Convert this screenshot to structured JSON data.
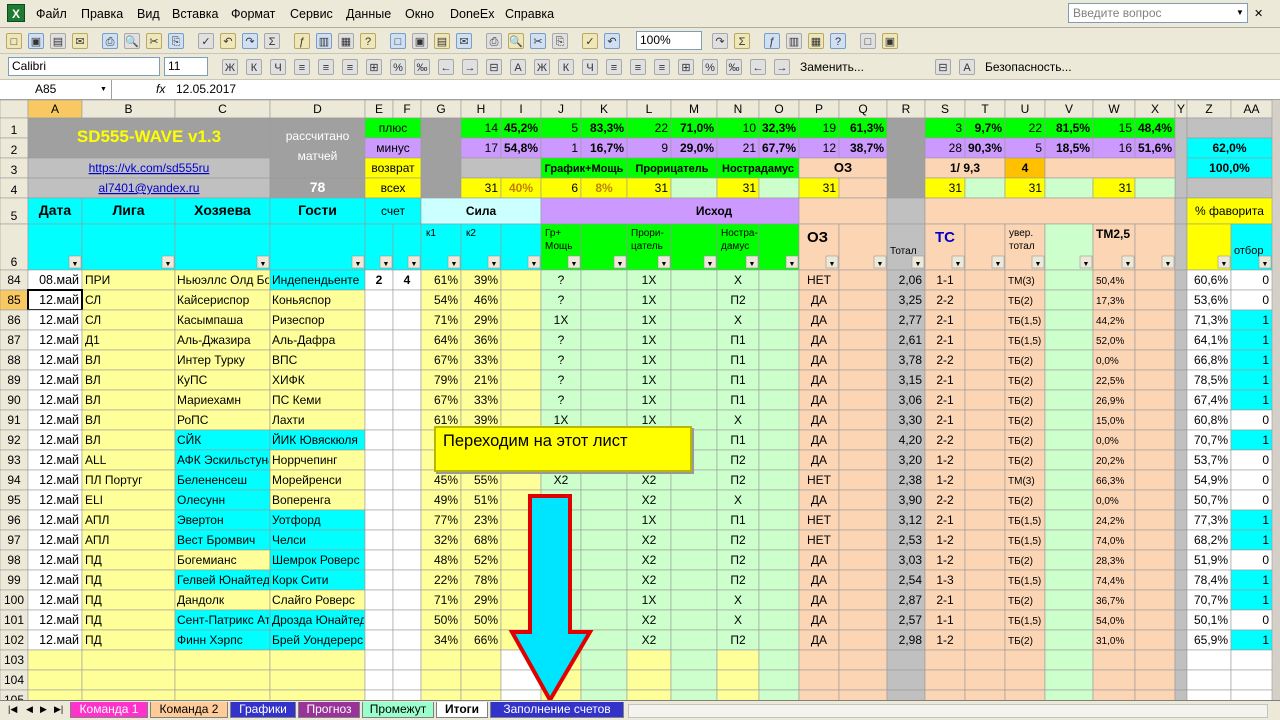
{
  "app": {
    "logo": "X",
    "menu": [
      "Файл",
      "Правка",
      "Вид",
      "Вставка",
      "Формат",
      "Сервис",
      "Данные",
      "Окно",
      "DoneEx",
      "Справка"
    ],
    "question_placeholder": "Введите вопрос"
  },
  "toolbar": {
    "zoom": "100%",
    "font": "Calibri",
    "font_size": "11",
    "replace_label": "Заменить...",
    "security_label": "Безопасность..."
  },
  "formula_bar": {
    "cell": "A85",
    "fx": "fx",
    "value": "12.05.2017"
  },
  "columns": [
    "A",
    "B",
    "C",
    "D",
    "E",
    "F",
    "G",
    "H",
    "I",
    "J",
    "K",
    "L",
    "M",
    "N",
    "O",
    "P",
    "Q",
    "R",
    "S",
    "T",
    "U",
    "V",
    "W",
    "X",
    "Y",
    "Z",
    "AA"
  ],
  "header": {
    "title": "SD555-WAVE v1.3",
    "link1": "https://vk.com/sd555ru",
    "link2": "al7401@yandex.ru",
    "calc_label": "рассчитано матчей",
    "calc_count": "78",
    "plus": "плюс",
    "minus": "минус",
    "ret": "возврат",
    "all": "всех",
    "r1": [
      "14",
      "45,2%",
      "5",
      "83,3%",
      "22",
      "71,0%",
      "10",
      "32,3%",
      "19",
      "61,3%",
      "3",
      "9,7%",
      "22",
      "81,5%",
      "15",
      "48,4%"
    ],
    "r2": [
      "17",
      "54,8%",
      "1",
      "16,7%",
      "9",
      "29,0%",
      "21",
      "67,7%",
      "12",
      "38,7%",
      "28",
      "90,3%",
      "5",
      "18,5%",
      "16",
      "51,6%"
    ],
    "z1": "62,0%",
    "z2": "100,0%",
    "r3": {
      "gm": "График+Мощь",
      "pr": "Прорицатель",
      "ns": "Нострадамус",
      "o3": "ОЗ",
      "s3": "1/ 9,3",
      "u3": "4"
    },
    "r4": {
      "h": "31",
      "i": "40%",
      "j": "6",
      "k": "8%",
      "l": "31",
      "n": "31",
      "p": "31",
      "s": "31",
      "u": "31",
      "w": "31"
    },
    "r5": {
      "date": "Дата",
      "league": "Лига",
      "home": "Хозяева",
      "away": "Гости",
      "score": "счет",
      "power": "Сила",
      "outcome": "Исход",
      "fav": "% фаворита"
    },
    "r6": {
      "k1": "к1",
      "k2": "к2",
      "grm": "Гр+ Мощь",
      "pror": "Проpи- цатель",
      "nostr": "Ностра- дамус",
      "oz": "ОЗ",
      "total": "Тотал",
      "tc": "ТС",
      "uvt": "увер. тотал",
      "tm25": "ТМ2,5",
      "otb": "отбор"
    }
  },
  "rows": [
    {
      "n": "84",
      "a": "08.май",
      "b": "ПРИ",
      "c": "Ньюэллс Олд Бойз",
      "d": "Индепендьенте",
      "e": "2",
      "f": "4",
      "g": "61%",
      "h": "39%",
      "j": "?",
      "l": "1Х",
      "n2": "Х",
      "p": "НЕТ",
      "r": "2,06",
      "s": "1-1",
      "u": "ТМ(3)",
      "w": "50,4%",
      "z": "60,6%",
      "aa": "0"
    },
    {
      "n": "85",
      "a": "12.май",
      "b": "СЛ",
      "c": "Кайсериспор",
      "d": "Коньяспор",
      "e": "",
      "f": "",
      "g": "54%",
      "h": "46%",
      "j": "?",
      "l": "1Х",
      "n2": "П2",
      "p": "ДА",
      "r": "3,25",
      "s": "2-2",
      "u": "ТБ(2)",
      "w": "17,3%",
      "z": "53,6%",
      "aa": "0"
    },
    {
      "n": "86",
      "a": "12.май",
      "b": "СЛ",
      "c": "Касымпаша",
      "d": "Ризеспор",
      "e": "",
      "f": "",
      "g": "71%",
      "h": "29%",
      "j": "1Х",
      "l": "1Х",
      "n2": "Х",
      "p": "ДА",
      "r": "2,77",
      "s": "2-1",
      "u": "ТБ(1,5)",
      "w": "44,2%",
      "z": "71,3%",
      "aa": "1"
    },
    {
      "n": "87",
      "a": "12.май",
      "b": "Д1",
      "c": "Аль-Джазира",
      "d": "Аль-Дафра",
      "e": "",
      "f": "",
      "g": "64%",
      "h": "36%",
      "j": "?",
      "l": "1Х",
      "n2": "П1",
      "p": "ДА",
      "r": "2,61",
      "s": "2-1",
      "u": "ТБ(1,5)",
      "w": "52,0%",
      "z": "64,1%",
      "aa": "1"
    },
    {
      "n": "88",
      "a": "12.май",
      "b": "ВЛ",
      "c": "Интер Турку",
      "d": "ВПС",
      "e": "",
      "f": "",
      "g": "67%",
      "h": "33%",
      "j": "?",
      "l": "1Х",
      "n2": "П1",
      "p": "ДА",
      "r": "3,78",
      "s": "2-2",
      "u": "ТБ(2)",
      "w": "0,0%",
      "z": "66,8%",
      "aa": "1"
    },
    {
      "n": "89",
      "a": "12.май",
      "b": "ВЛ",
      "c": "КуПС",
      "d": "ХИФК",
      "e": "",
      "f": "",
      "g": "79%",
      "h": "21%",
      "j": "?",
      "l": "1Х",
      "n2": "П1",
      "p": "ДА",
      "r": "3,15",
      "s": "2-1",
      "u": "ТБ(2)",
      "w": "22,5%",
      "z": "78,5%",
      "aa": "1"
    },
    {
      "n": "90",
      "a": "12.май",
      "b": "ВЛ",
      "c": "Мариехамн",
      "d": "ПС Кеми",
      "e": "",
      "f": "",
      "g": "67%",
      "h": "33%",
      "j": "?",
      "l": "1Х",
      "n2": "П1",
      "p": "ДА",
      "r": "3,06",
      "s": "2-1",
      "u": "ТБ(2)",
      "w": "26,9%",
      "z": "67,4%",
      "aa": "1"
    },
    {
      "n": "91",
      "a": "12.май",
      "b": "ВЛ",
      "c": "РоПС",
      "d": "Лахти",
      "e": "",
      "f": "",
      "g": "61%",
      "h": "39%",
      "j": "1Х",
      "l": "1Х",
      "n2": "Х",
      "p": "ДА",
      "r": "3,30",
      "s": "2-1",
      "u": "ТБ(2)",
      "w": "15,0%",
      "z": "60,8%",
      "aa": "0"
    },
    {
      "n": "92",
      "a": "12.май",
      "b": "ВЛ",
      "c": "СЙК",
      "d": "ЙИК Ювяскюля",
      "e": "",
      "f": "",
      "g": "7",
      "h": "",
      "j": "",
      "l": "",
      "n2": "П1",
      "p": "ДА",
      "r": "4,20",
      "s": "2-2",
      "u": "ТБ(2)",
      "w": "0,0%",
      "z": "70,7%",
      "aa": "1"
    },
    {
      "n": "93",
      "a": "12.май",
      "b": "ALL",
      "c": "АФК Эскильстуна",
      "d": "Норрчепинг",
      "e": "",
      "f": "",
      "g": "",
      "h": "",
      "j": "",
      "l": "",
      "n2": "П2",
      "p": "ДА",
      "r": "3,20",
      "s": "1-2",
      "u": "ТБ(2)",
      "w": "20,2%",
      "z": "53,7%",
      "aa": "0"
    },
    {
      "n": "94",
      "a": "12.май",
      "b": "ПЛ Португ",
      "c": "Белененсеш",
      "d": "Морейренси",
      "e": "",
      "f": "",
      "g": "45%",
      "h": "55%",
      "j": "Х2",
      "l": "Х2",
      "n2": "П2",
      "p": "НЕТ",
      "r": "2,38",
      "s": "1-2",
      "u": "ТМ(3)",
      "w": "66,3%",
      "z": "54,9%",
      "aa": "0"
    },
    {
      "n": "95",
      "a": "12.май",
      "b": "ELI",
      "c": "Олесунн",
      "d": "Воперенга",
      "e": "",
      "f": "",
      "g": "49%",
      "h": "51%",
      "j": "",
      "l": "Х2",
      "n2": "Х",
      "p": "ДА",
      "r": "3,90",
      "s": "2-2",
      "u": "ТБ(2)",
      "w": "0,0%",
      "z": "50,7%",
      "aa": "0"
    },
    {
      "n": "96",
      "a": "12.май",
      "b": "АПЛ",
      "c": "Эвертон",
      "d": "Уотфорд",
      "e": "",
      "f": "",
      "g": "77%",
      "h": "23%",
      "j": "",
      "l": "1Х",
      "n2": "П1",
      "p": "НЕТ",
      "r": "3,12",
      "s": "2-1",
      "u": "ТБ(1,5)",
      "w": "24,2%",
      "z": "77,3%",
      "aa": "1"
    },
    {
      "n": "97",
      "a": "12.май",
      "b": "АПЛ",
      "c": "Вест Бромвич",
      "d": "Челси",
      "e": "",
      "f": "",
      "g": "32%",
      "h": "68%",
      "j": "",
      "l": "Х2",
      "n2": "П2",
      "p": "НЕТ",
      "r": "2,53",
      "s": "1-2",
      "u": "ТБ(1,5)",
      "w": "74,0%",
      "z": "68,2%",
      "aa": "1"
    },
    {
      "n": "98",
      "a": "12.май",
      "b": "ПД",
      "c": "Богемианс",
      "d": "Шемрок Роверс",
      "e": "",
      "f": "",
      "g": "48%",
      "h": "52%",
      "j": "",
      "l": "Х2",
      "n2": "П2",
      "p": "ДА",
      "r": "3,03",
      "s": "1-2",
      "u": "ТБ(2)",
      "w": "28,3%",
      "z": "51,9%",
      "aa": "0"
    },
    {
      "n": "99",
      "a": "12.май",
      "b": "ПД",
      "c": "Гелвей Юнайтед",
      "d": "Корк Сити",
      "e": "",
      "f": "",
      "g": "22%",
      "h": "78%",
      "j": "",
      "l": "Х2",
      "n2": "П2",
      "p": "ДА",
      "r": "2,54",
      "s": "1-3",
      "u": "ТБ(1,5)",
      "w": "74,4%",
      "z": "78,4%",
      "aa": "1"
    },
    {
      "n": "100",
      "a": "12.май",
      "b": "ПД",
      "c": "Дандолк",
      "d": "Слайго Роверс",
      "e": "",
      "f": "",
      "g": "71%",
      "h": "29%",
      "j": "",
      "l": "1Х",
      "n2": "Х",
      "p": "ДА",
      "r": "2,87",
      "s": "2-1",
      "u": "ТБ(2)",
      "w": "36,7%",
      "z": "70,7%",
      "aa": "1"
    },
    {
      "n": "101",
      "a": "12.май",
      "b": "ПД",
      "c": "Сент-Патрикс Атл",
      "d": "Дрозда Юнайтед",
      "e": "",
      "f": "",
      "g": "50%",
      "h": "50%",
      "j": "",
      "l": "Х2",
      "n2": "Х",
      "p": "ДА",
      "r": "2,57",
      "s": "1-1",
      "u": "ТБ(1,5)",
      "w": "54,0%",
      "z": "50,1%",
      "aa": "0"
    },
    {
      "n": "102",
      "a": "12.май",
      "b": "ПД",
      "c": "Финн Хэрпс",
      "d": "Брей Уондерерс",
      "e": "",
      "f": "",
      "g": "34%",
      "h": "66%",
      "j": "",
      "l": "Х2",
      "n2": "П2",
      "p": "ДА",
      "r": "2,98",
      "s": "1-2",
      "u": "ТБ(2)",
      "w": "31,0%",
      "z": "65,9%",
      "aa": "1"
    },
    {
      "n": "103"
    },
    {
      "n": "104"
    },
    {
      "n": "105"
    }
  ],
  "callout": "Переходим на этот лист",
  "sheets": [
    "Команда 1",
    "Команда 2",
    "Графики",
    "Прогноз",
    "Промежут",
    "Итоги",
    "Заполнение счетов"
  ]
}
